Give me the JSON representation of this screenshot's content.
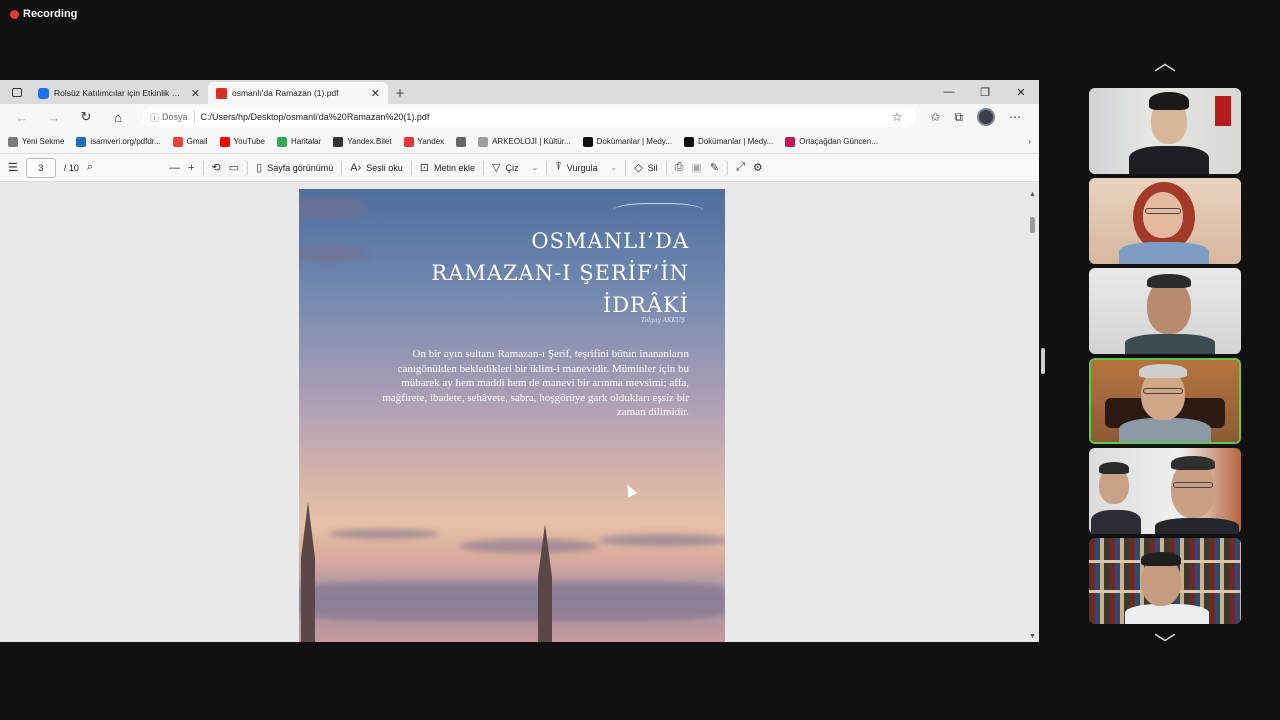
{
  "recording": {
    "label": "Recording"
  },
  "browser": {
    "tabs": [
      {
        "label": "Rolsüz Katılımcılar için Etkinlik Sa...",
        "active": false
      },
      {
        "label": "osmanlı'da Ramazan (1).pdf",
        "active": true
      }
    ],
    "address": {
      "security_label": "Dosya",
      "url": "C:/Users/hp/Desktop/osmanli'da%20Ramazan%20(1).pdf"
    },
    "bookmarks": [
      {
        "label": "Yeni Sekme",
        "color": "#7a7a7a"
      },
      {
        "label": "isamveri.org/pdfdr...",
        "color": "#1e6fb8"
      },
      {
        "label": "Gmail",
        "color": "#ea4335"
      },
      {
        "label": "YouTube",
        "color": "#ff0000"
      },
      {
        "label": "Haritalar",
        "color": "#34a853"
      },
      {
        "label": "Yandex.Bilet",
        "color": "#333333"
      },
      {
        "label": "Yandex",
        "color": "#e53935"
      },
      {
        "label": "",
        "color": "#666666"
      },
      {
        "label": "ARKEOLOJİ | Kültür...",
        "color": "#9e9e9e"
      },
      {
        "label": "Dokümanlar | Medy...",
        "color": "#111111"
      },
      {
        "label": "Dokümanlar | Medy...",
        "color": "#111111"
      },
      {
        "label": "Ortaçağdan Güncen...",
        "color": "#c2185b"
      }
    ],
    "pdf_toolbar": {
      "page_current": "3",
      "page_total": "/ 10",
      "page_view_label": "Sayfa görünümü",
      "read_aloud_label": "Sesli oku",
      "add_text_label": "Metin ekle",
      "draw_label": "Çiz",
      "highlight_label": "Vurgula",
      "erase_label": "Sil"
    }
  },
  "document": {
    "title_lines": [
      "OSMANLI’DA",
      "RAMAZAN-I ŞERİF’İN",
      "İDRÂKİ"
    ],
    "author": "Tolgay AKKUŞ",
    "body": "On bir ayın sultanı Ramazan-ı Şerif, teşrifini bütün inananların canıgönülden bekledikleri bir iklim-i manevidir.  Müminler için bu mübarek ay hem maddi hem de manevi bir arınma mevsimi; affa, mağfirete, ibadete, sehâvete, sabra, hoşgörüye gark oldukları eşsiz bir zaman dilimidir."
  },
  "participants": [
    {
      "name": "participant-1",
      "speaking": false
    },
    {
      "name": "participant-2",
      "speaking": false
    },
    {
      "name": "participant-3",
      "speaking": false
    },
    {
      "name": "participant-4",
      "speaking": true
    },
    {
      "name": "participant-5",
      "speaking": false
    },
    {
      "name": "participant-6",
      "speaking": false
    }
  ],
  "icons": {
    "scroll_up": "chevron-up-icon",
    "scroll_down": "chevron-down-icon"
  }
}
